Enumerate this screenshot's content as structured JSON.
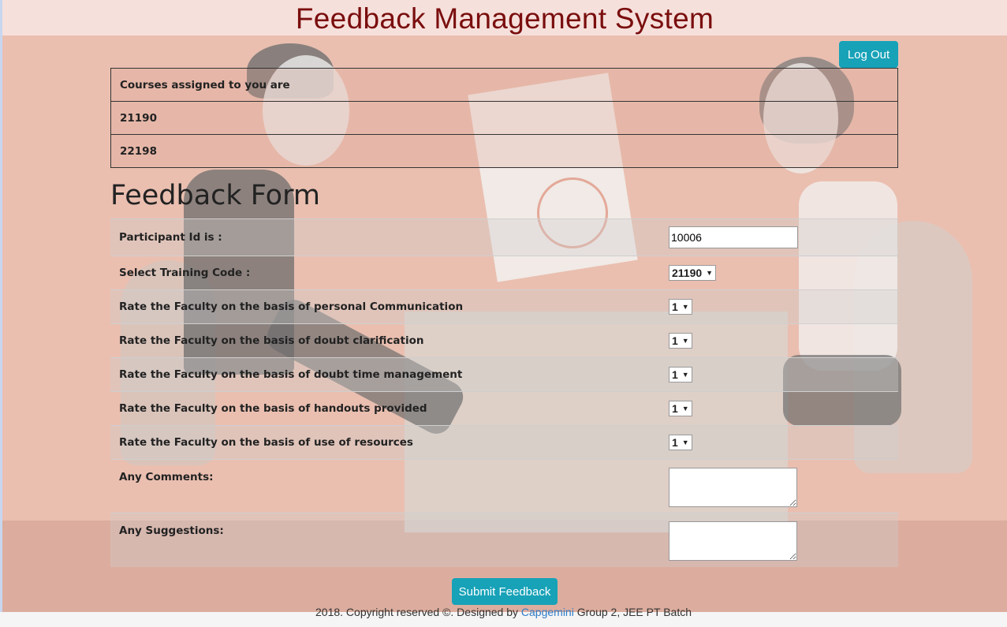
{
  "app": {
    "title": "Feedback Management System"
  },
  "header": {
    "logout_label": "Log Out"
  },
  "courses": {
    "heading": "Courses assigned to you are",
    "items": [
      "21190",
      "22198"
    ]
  },
  "form": {
    "title": "Feedback Form",
    "participant": {
      "label": "Participant Id is :",
      "value": "10006"
    },
    "training_code": {
      "label": "Select Training Code :",
      "value": "21190"
    },
    "ratings": [
      {
        "label": "Rate the Faculty on the basis of personal Communication",
        "value": "1"
      },
      {
        "label": "Rate the Faculty on the basis of doubt clarification",
        "value": "1"
      },
      {
        "label": "Rate the Faculty on the basis of doubt time management",
        "value": "1"
      },
      {
        "label": "Rate the Faculty on the basis of handouts provided",
        "value": "1"
      },
      {
        "label": "Rate the Faculty on the basis of use of resources",
        "value": "1"
      }
    ],
    "comments": {
      "label": "Any Comments:",
      "value": ""
    },
    "suggestions": {
      "label": "Any Suggestions:",
      "value": ""
    },
    "submit_label": "Submit Feedback"
  },
  "footer": {
    "prefix": "2018. Copyright reserved ©. Designed by ",
    "link": "Capgemini",
    "suffix": " Group 2, JEE PT Batch"
  },
  "colors": {
    "accent": "#17a2b8",
    "title": "#7a0e0e",
    "background": "#eabfb0",
    "header_bg": "#f6e0dc"
  }
}
